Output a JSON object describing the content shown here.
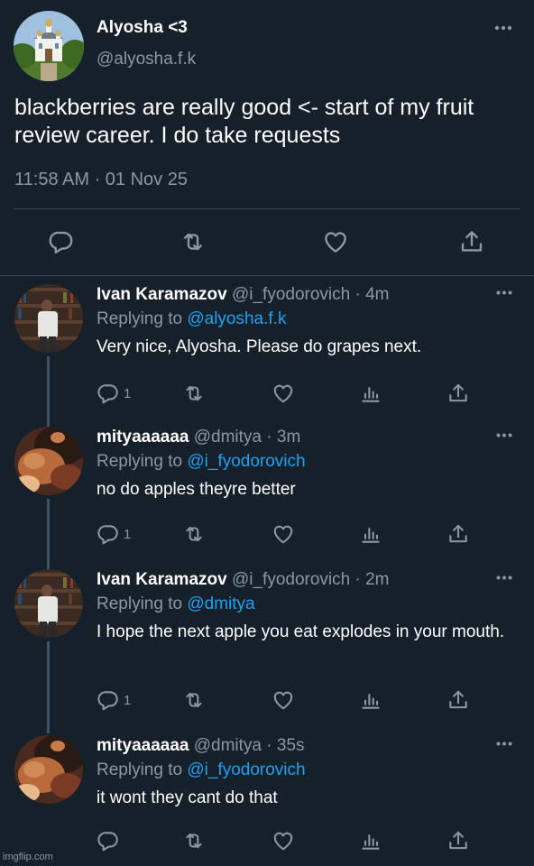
{
  "main_tweet": {
    "author_name": "Alyosha <3",
    "author_handle": "@alyosha.f.k",
    "text": "blackberries are really good <- start of my fruit review career. I do take requests",
    "timestamp": "11:58 AM · 01 Nov 25",
    "avatar_icon": "monastery-avatar",
    "actions": [
      "reply-icon",
      "retweet-icon",
      "like-icon",
      "share-icon"
    ]
  },
  "replies": [
    {
      "author_name": "Ivan Karamazov",
      "author_handle": "@i_fyodorovich",
      "time": "· 4m",
      "replying_label": "Replying to",
      "replying_to": "@alyosha.f.k",
      "text": "Very nice, Alyosha. Please do grapes next.",
      "reply_count": "1"
    },
    {
      "author_name": "mityaaaaaa",
      "author_handle": "@dmitya",
      "time": "· 3m",
      "replying_label": "Replying to",
      "replying_to": "@i_fyodorovich",
      "text": "no do apples theyre better",
      "reply_count": "1"
    },
    {
      "author_name": "Ivan Karamazov",
      "author_handle": "@i_fyodorovich",
      "time": "· 2m",
      "replying_label": "Replying to",
      "replying_to": "@dmitya",
      "text": "I hope the next apple you eat explodes in your mouth.",
      "reply_count": "1"
    },
    {
      "author_name": "mityaaaaaa",
      "author_handle": "@dmitya",
      "time": "· 35s",
      "replying_label": "Replying to",
      "replying_to": "@i_fyodorovich",
      "text": "it wont they cant do that",
      "reply_count": ""
    }
  ],
  "watermark": "imgflip.com",
  "colors": {
    "background": "#15202b",
    "secondary_text": "#8899a6",
    "link": "#1da1f2",
    "divider": "#38444d",
    "thread_line": "#3d5466"
  }
}
